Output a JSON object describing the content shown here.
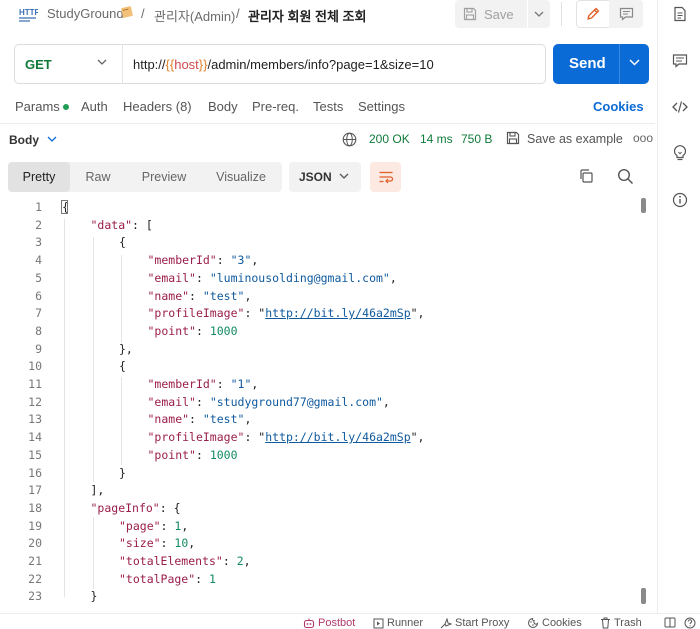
{
  "breadcrumb": {
    "workspace": "StudyGround",
    "folder": "관리자(Admin)",
    "request": "관리자 회원 전체 조회",
    "separator": "/"
  },
  "toolbar": {
    "save_label": "Save"
  },
  "request": {
    "method": "GET",
    "url_prefix": "http://",
    "url_brace_open": "{{",
    "url_var": "host",
    "url_brace_close": "}}",
    "url_path": "/admin/members/info?page=1&size=10",
    "send_label": "Send"
  },
  "request_tabs": {
    "params": "Params",
    "auth": "Auth",
    "headers": "Headers (8)",
    "body": "Body",
    "prereq": "Pre-req.",
    "tests": "Tests",
    "settings": "Settings",
    "cookies": "Cookies"
  },
  "response": {
    "body_label": "Body",
    "status": "200 OK",
    "time": "14 ms",
    "size": "750 B",
    "save_example": "Save as example",
    "more": "ooo"
  },
  "view_tabs": {
    "pretty": "Pretty",
    "raw": "Raw",
    "preview": "Preview",
    "visualize": "Visualize",
    "format": "JSON"
  },
  "code": {
    "line_numbers": [
      "1",
      "2",
      "3",
      "4",
      "5",
      "6",
      "7",
      "8",
      "9",
      "10",
      "11",
      "12",
      "13",
      "14",
      "15",
      "16",
      "17",
      "18",
      "19",
      "20",
      "21",
      "22",
      "23"
    ],
    "k_data": "\"data\"",
    "k_memberId": "\"memberId\"",
    "k_email": "\"email\"",
    "k_name": "\"name\"",
    "k_profileImage": "\"profileImage\"",
    "k_point": "\"point\"",
    "k_pageInfo": "\"pageInfo\"",
    "k_page": "\"page\"",
    "k_size": "\"size\"",
    "k_totalElements": "\"totalElements\"",
    "k_totalPage": "\"totalPage\"",
    "m1_id": "\"3\"",
    "m1_email": "\"luminousolding@gmail.com\"",
    "m1_name": "\"test\"",
    "m1_img": "http://bit.ly/46a2mSp",
    "m1_point": "1000",
    "m2_id": "\"1\"",
    "m2_email": "\"studyground77@gmail.com\"",
    "m2_name": "\"test\"",
    "m2_img": "http://bit.ly/46a2mSp",
    "m2_point": "1000",
    "page": "1",
    "size": "10",
    "totalElements": "2",
    "totalPage": "1"
  },
  "footer": {
    "postbot": "Postbot",
    "runner": "Runner",
    "start_proxy": "Start Proxy",
    "cookies": "Cookies",
    "trash": "Trash"
  },
  "colors": {
    "accent": "#0b6bd6",
    "method_get": "#117a3a",
    "status_ok": "#117a3a",
    "json_key": "#9a1e4b",
    "json_string": "#0f5a9e",
    "json_number": "#138a63"
  }
}
